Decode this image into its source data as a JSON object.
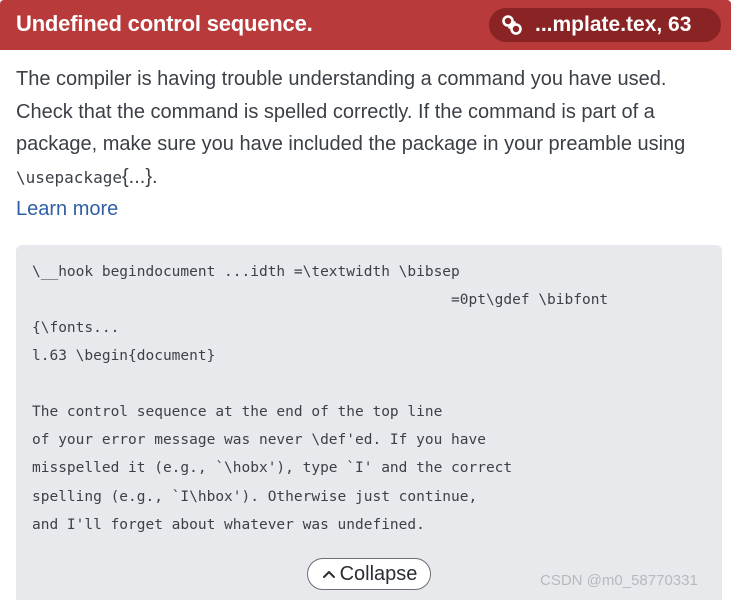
{
  "header": {
    "title": "Undefined control sequence.",
    "file_label": "...mplate.tex, 63",
    "link_icon": "link-icon",
    "background_color": "#b83a3a",
    "pill_color": "#8a2424"
  },
  "message": {
    "line1": "The compiler is having trouble understanding a command you have used.",
    "line2": "Check that the command is spelled correctly. If the command is part of a",
    "line3": "package, make sure you have included the package in your preamble using",
    "code": "\\usepackage",
    "code_suffix": "{...}."
  },
  "learn_more": {
    "label": "Learn more",
    "color": "#2f5fa6"
  },
  "log": {
    "lines": [
      "\\__hook begindocument ...idth =\\textwidth \\bibsep",
      "                                                =0pt\\gdef \\bibfont",
      "{\\fonts...",
      "l.63 \\begin{document}",
      "",
      "The control sequence at the end of the top line",
      "of your error message was never \\def'ed. If you have",
      "misspelled it (e.g., `\\hobx'), type `I' and the correct",
      "spelling (e.g., `I\\hbox'). Otherwise just continue,",
      "and I'll forget about whatever was undefined."
    ]
  },
  "collapse": {
    "label": "Collapse",
    "icon": "chevron-up-icon"
  },
  "watermark": {
    "text": "CSDN @m0_58770331"
  }
}
